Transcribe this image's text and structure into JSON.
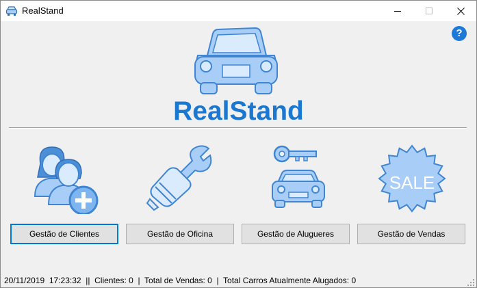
{
  "window": {
    "title": "RealStand",
    "app_icon": "car-icon"
  },
  "controls": {
    "minimize": "minimize-icon",
    "maximize": "maximize-icon",
    "close": "close-icon"
  },
  "help": {
    "label": "?"
  },
  "brand": {
    "name": "RealStand"
  },
  "tiles": [
    {
      "icon": "add-client-icon",
      "label": "Gestão de Clientes"
    },
    {
      "icon": "wrench-icon",
      "label": "Gestão de Oficina"
    },
    {
      "icon": "car-key-icon",
      "label": "Gestão de Alugueres"
    },
    {
      "icon": "sale-badge-icon",
      "label": "Gestão de Vendas",
      "badge_text": "SALE"
    }
  ],
  "status": {
    "text": "20/11/2019  17:23:32  ||  Clientes: 0  |  Total de Vendas: 0  |  Total Carros Atualmente Alugados: 0"
  },
  "colors": {
    "brand": "#1b78d0",
    "icon_fill": "#a8cdf6",
    "icon_stroke": "#4d8fd6",
    "focus": "#0078d7"
  }
}
